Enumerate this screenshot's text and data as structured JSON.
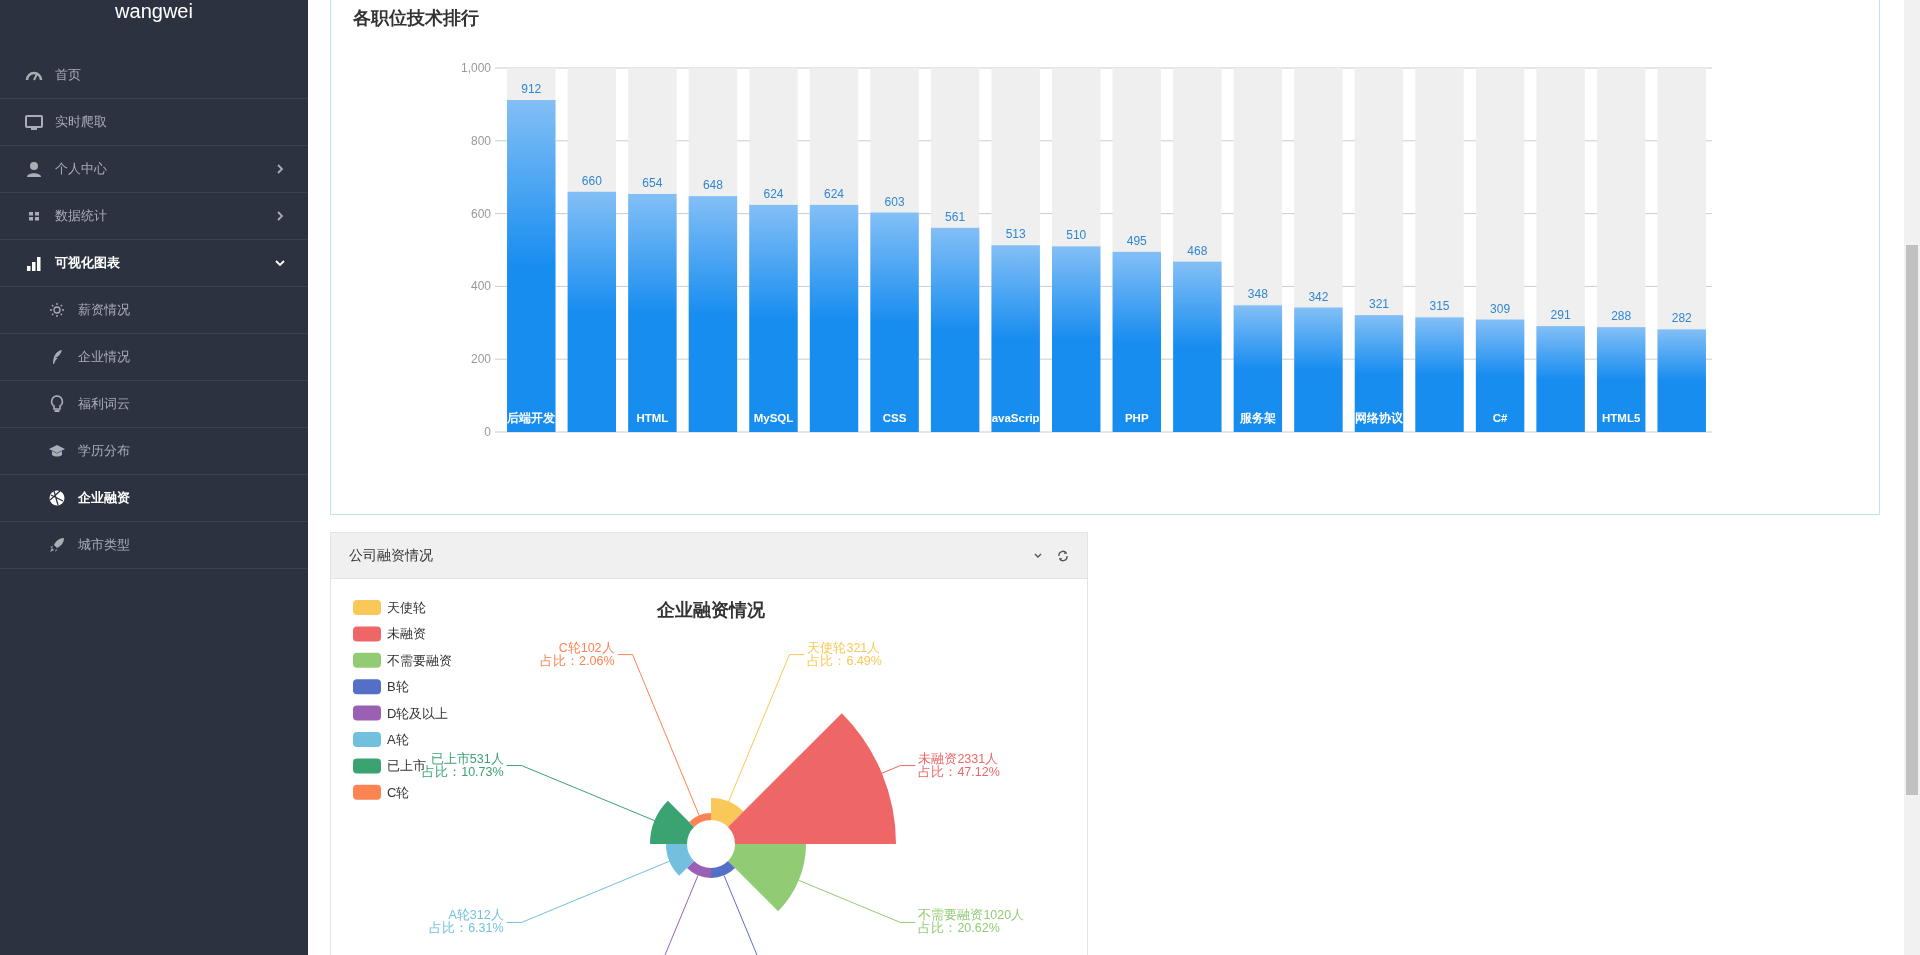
{
  "sidebar": {
    "brand": "wangwei",
    "items": [
      {
        "label": "首页",
        "selected": false
      },
      {
        "label": "实时爬取",
        "selected": false
      },
      {
        "label": "个人中心",
        "selected": false,
        "expanded": false
      },
      {
        "label": "数据统计",
        "selected": false,
        "expanded": false
      },
      {
        "label": "可视化图表",
        "selected": false,
        "expanded": true,
        "children": [
          {
            "label": "薪资情况",
            "selected": false
          },
          {
            "label": "企业情况",
            "selected": false
          },
          {
            "label": "福利词云",
            "selected": false
          },
          {
            "label": "学历分布",
            "selected": false
          },
          {
            "label": "企业融资",
            "selected": true
          },
          {
            "label": "城市类型",
            "selected": false
          }
        ]
      }
    ]
  },
  "bar_panel": {
    "chart_data": {
      "type": "bar",
      "title": "各职位技术排行",
      "categories": [
        "后端开发",
        null,
        "HTML",
        null,
        "MySQL",
        null,
        "CSS",
        null,
        "avaScrip",
        null,
        "PHP",
        null,
        "服务架",
        null,
        "网络协议",
        null,
        "C#",
        null,
        "HTML5",
        null
      ],
      "values": [
        912,
        660,
        654,
        648,
        624,
        624,
        603,
        561,
        513,
        510,
        495,
        468,
        348,
        342,
        321,
        315,
        309,
        291,
        288,
        282
      ],
      "ylim": [
        0,
        1000
      ],
      "grid": true,
      "yticks": [
        0,
        200,
        400,
        600,
        800,
        {
          "value": 1000,
          "label": "1,000"
        }
      ],
      "data_labels": true
    }
  },
  "funding_panel": {
    "title": "公司融资情况",
    "chart_title": "企业融资情况",
    "legend": [
      {
        "label": "天使轮",
        "color": "#fac858"
      },
      {
        "label": "未融资",
        "color": "#ee6666"
      },
      {
        "label": "不需要融资",
        "color": "#91cc75"
      },
      {
        "label": "B轮",
        "color": "#5470c6"
      },
      {
        "label": "D轮及以上",
        "color": "#9a60b4"
      },
      {
        "label": "A轮",
        "color": "#73c0de"
      },
      {
        "label": "已上市",
        "color": "#3ba272"
      },
      {
        "label": "C轮",
        "color": "#fc8452"
      }
    ],
    "slice_labels": [
      {
        "text": "C轮102人",
        "share": "占比：2.06%"
      },
      {
        "text": "天使轮321人",
        "share": "占比：6.49%"
      },
      {
        "text": "已上市531人",
        "share": "占比：10.73%"
      },
      {
        "text": "未融资2331人",
        "share": "占比：47.12%"
      },
      {
        "text": "A轮312人",
        "share": "占比：6.31%"
      },
      {
        "text": "不需要融资1020人",
        "share": "占比：20.62%"
      }
    ]
  }
}
